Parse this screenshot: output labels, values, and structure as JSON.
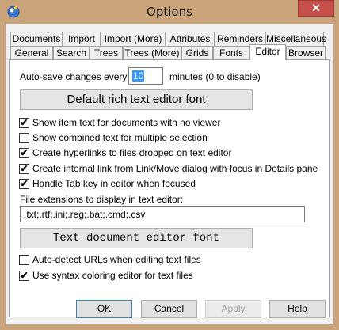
{
  "window": {
    "title": "Options",
    "close_glyph": "✕"
  },
  "tabs_row1": [
    {
      "label": "Documents"
    },
    {
      "label": "Import"
    },
    {
      "label": "Import (More)"
    },
    {
      "label": "Attributes"
    },
    {
      "label": "Reminders"
    },
    {
      "label": "Miscellaneous"
    }
  ],
  "tabs_row2": [
    {
      "label": "General"
    },
    {
      "label": "Search"
    },
    {
      "label": "Trees"
    },
    {
      "label": "Trees (More)"
    },
    {
      "label": "Grids"
    },
    {
      "label": "Fonts"
    },
    {
      "label": "Editor",
      "active": true
    },
    {
      "label": "Browser"
    }
  ],
  "editor": {
    "autosave_label": "Auto-save changes every",
    "autosave_value": "10",
    "autosave_suffix": "minutes (0 to disable)",
    "rich_font_button": "Default rich text editor font",
    "checkboxes": [
      {
        "label": "Show item text for documents with no viewer",
        "checked": true
      },
      {
        "label": "Show combined text for multiple selection",
        "checked": false
      },
      {
        "label": "Create hyperlinks to files dropped on text editor",
        "checked": true
      },
      {
        "label": "Create internal link from Link/Move dialog with focus in Details pane",
        "checked": true
      },
      {
        "label": "Handle Tab key in editor when focused",
        "checked": true
      }
    ],
    "extensions_label": "File extensions to display in text editor:",
    "extensions_value": ".txt;.rtf;.ini;.reg;.bat;.cmd;.csv",
    "text_font_button": "Text document editor font",
    "checkboxes2": [
      {
        "label": "Auto-detect URLs when editing text files",
        "checked": false
      },
      {
        "label": "Use syntax coloring editor for text files",
        "checked": true
      }
    ],
    "check_glyph": "✔"
  },
  "buttons": {
    "ok": "OK",
    "cancel": "Cancel",
    "apply": "Apply",
    "help": "Help"
  },
  "colors": {
    "titlebar": "#c9a37a",
    "close": "#c7504a",
    "selection": "#3399ff"
  }
}
